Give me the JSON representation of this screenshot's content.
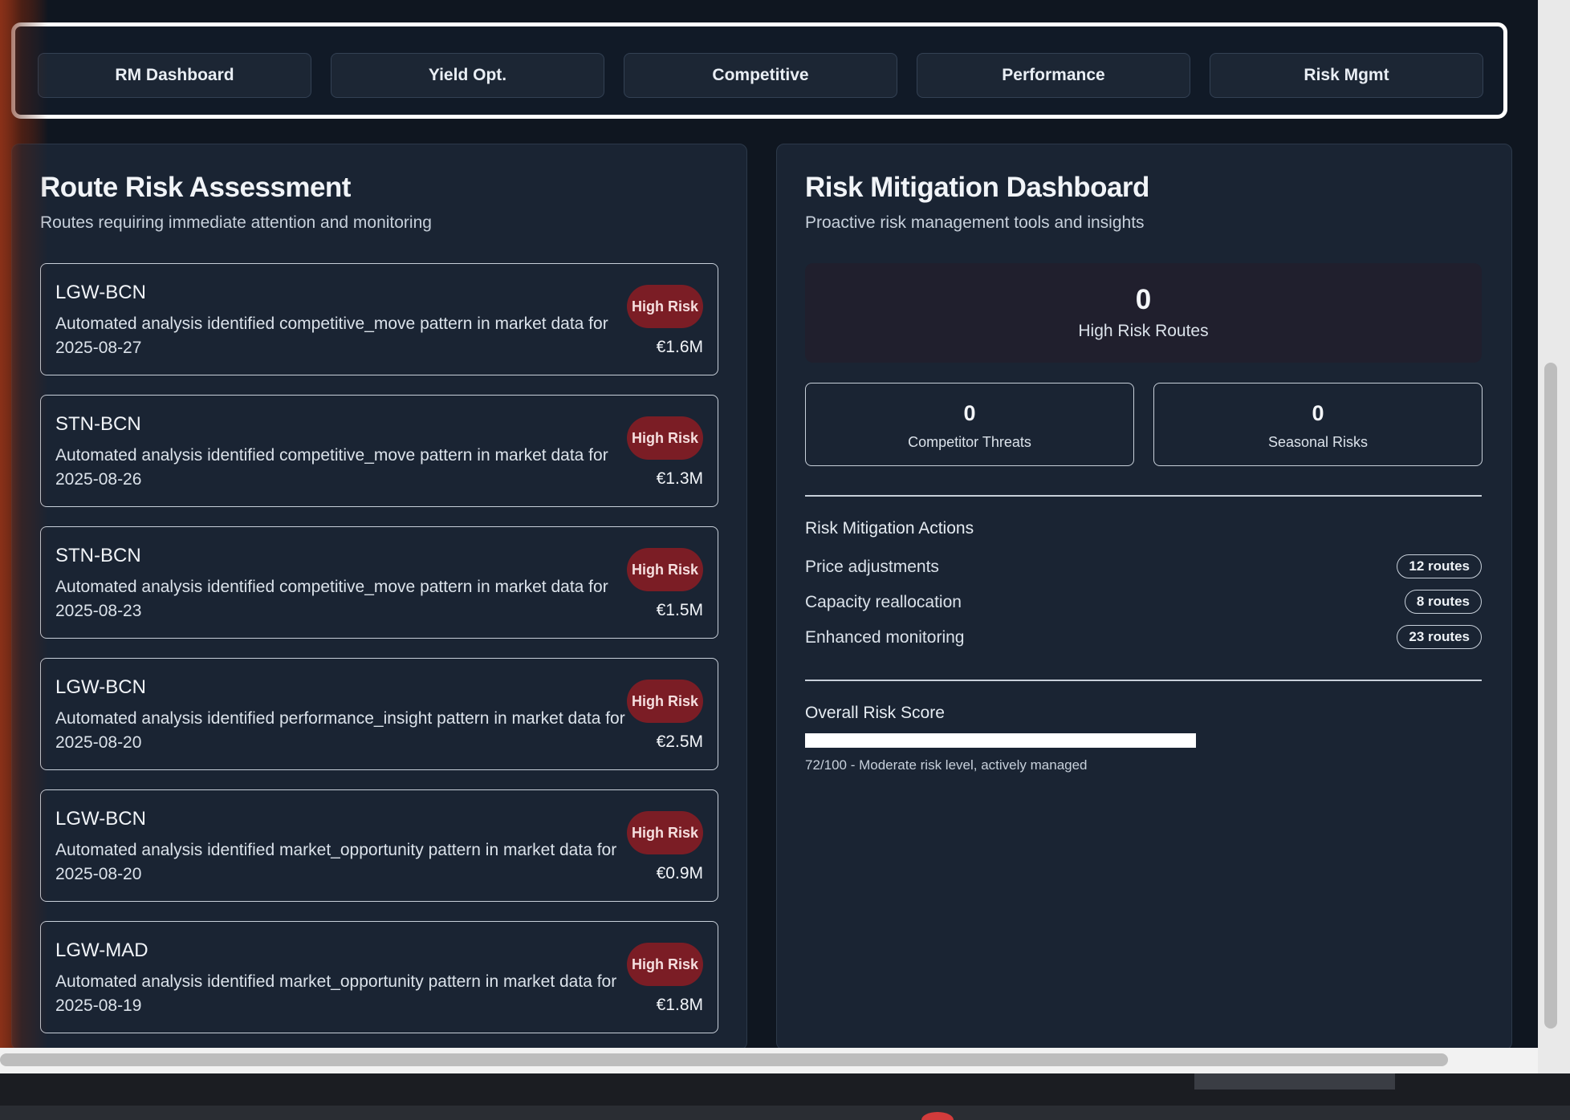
{
  "tabs": [
    {
      "label": "RM Dashboard"
    },
    {
      "label": "Yield Opt."
    },
    {
      "label": "Competitive"
    },
    {
      "label": "Performance"
    },
    {
      "label": "Risk Mgmt"
    }
  ],
  "left_panel": {
    "title": "Route Risk Assessment",
    "subtitle": "Routes requiring immediate attention and monitoring",
    "cards": [
      {
        "route": "LGW-BCN",
        "description": "Automated analysis identified competitive_move pattern in market data for 2025-08-27",
        "badge": "High Risk",
        "amount": "€1.6M"
      },
      {
        "route": "STN-BCN",
        "description": "Automated analysis identified competitive_move pattern in market data for 2025-08-26",
        "badge": "High Risk",
        "amount": "€1.3M"
      },
      {
        "route": "STN-BCN",
        "description": "Automated analysis identified competitive_move pattern in market data for 2025-08-23",
        "badge": "High Risk",
        "amount": "€1.5M"
      },
      {
        "route": "LGW-BCN",
        "description": "Automated analysis identified performance_insight pattern in market data for 2025-08-20",
        "badge": "High Risk",
        "amount": "€2.5M"
      },
      {
        "route": "LGW-BCN",
        "description": "Automated analysis identified market_opportunity pattern in market data for 2025-08-20",
        "badge": "High Risk",
        "amount": "€0.9M"
      },
      {
        "route": "LGW-MAD",
        "description": "Automated analysis identified market_opportunity pattern in market data for 2025-08-19",
        "badge": "High Risk",
        "amount": "€1.8M"
      }
    ]
  },
  "right_panel": {
    "title": "Risk Mitigation Dashboard",
    "subtitle": "Proactive risk management tools and insights",
    "high_risk": {
      "value": "0",
      "label": "High Risk Routes"
    },
    "competitor_threats": {
      "value": "0",
      "label": "Competitor Threats"
    },
    "seasonal_risks": {
      "value": "0",
      "label": "Seasonal Risks"
    },
    "actions_heading": "Risk Mitigation Actions",
    "actions": [
      {
        "label": "Price adjustments",
        "count": "12 routes"
      },
      {
        "label": "Capacity reallocation",
        "count": "8 routes"
      },
      {
        "label": "Enhanced monitoring",
        "count": "23 routes"
      }
    ],
    "score_heading": "Overall Risk Score",
    "score_fraction": 0.578,
    "score_note": "72/100 - Moderate risk level, actively managed"
  },
  "colors": {
    "badge_bg": "#7b1d25",
    "panel_bg": "#1a2433",
    "page_bg": "#0f1620"
  }
}
